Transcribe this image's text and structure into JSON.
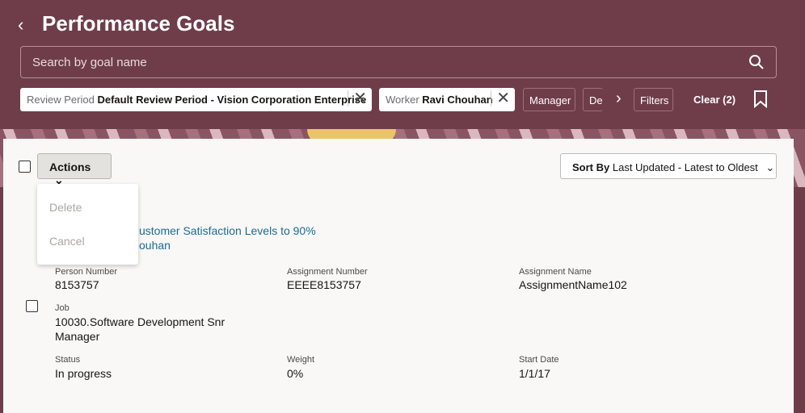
{
  "header": {
    "back": "‹",
    "title": "Performance Goals",
    "search_placeholder": "Search by goal name"
  },
  "filters": {
    "chips": [
      {
        "label": "Review Period",
        "value": "Default Review Period - Vision Corporation Enterprise"
      },
      {
        "label": "Worker",
        "value": "Ravi Chouhan"
      }
    ],
    "manager": "Manager",
    "dept": "Dep",
    "more": "›",
    "filters": "Filters",
    "clear": "Clear (2)"
  },
  "toolbar": {
    "actions": "Actions",
    "sort_label": "Sort By",
    "sort_value": "Last Updated - Latest to Oldest"
  },
  "menu": {
    "items": [
      "Delete",
      "Cancel"
    ]
  },
  "goal": {
    "title": "ustomer Satisfaction Levels to 90%",
    "worker": "ouhan",
    "fields": [
      {
        "label": "Person Number",
        "value": "8153757"
      },
      {
        "label": "Assignment Number",
        "value": "EEEE8153757"
      },
      {
        "label": "Assignment Name",
        "value": "AssignmentName102"
      },
      {
        "label": "Job",
        "value": "10030.Software Development Snr Manager"
      },
      {
        "label": "Status",
        "value": "In progress"
      },
      {
        "label": "Weight",
        "value": "0%"
      },
      {
        "label": "Start Date",
        "value": "1/1/17"
      }
    ]
  }
}
